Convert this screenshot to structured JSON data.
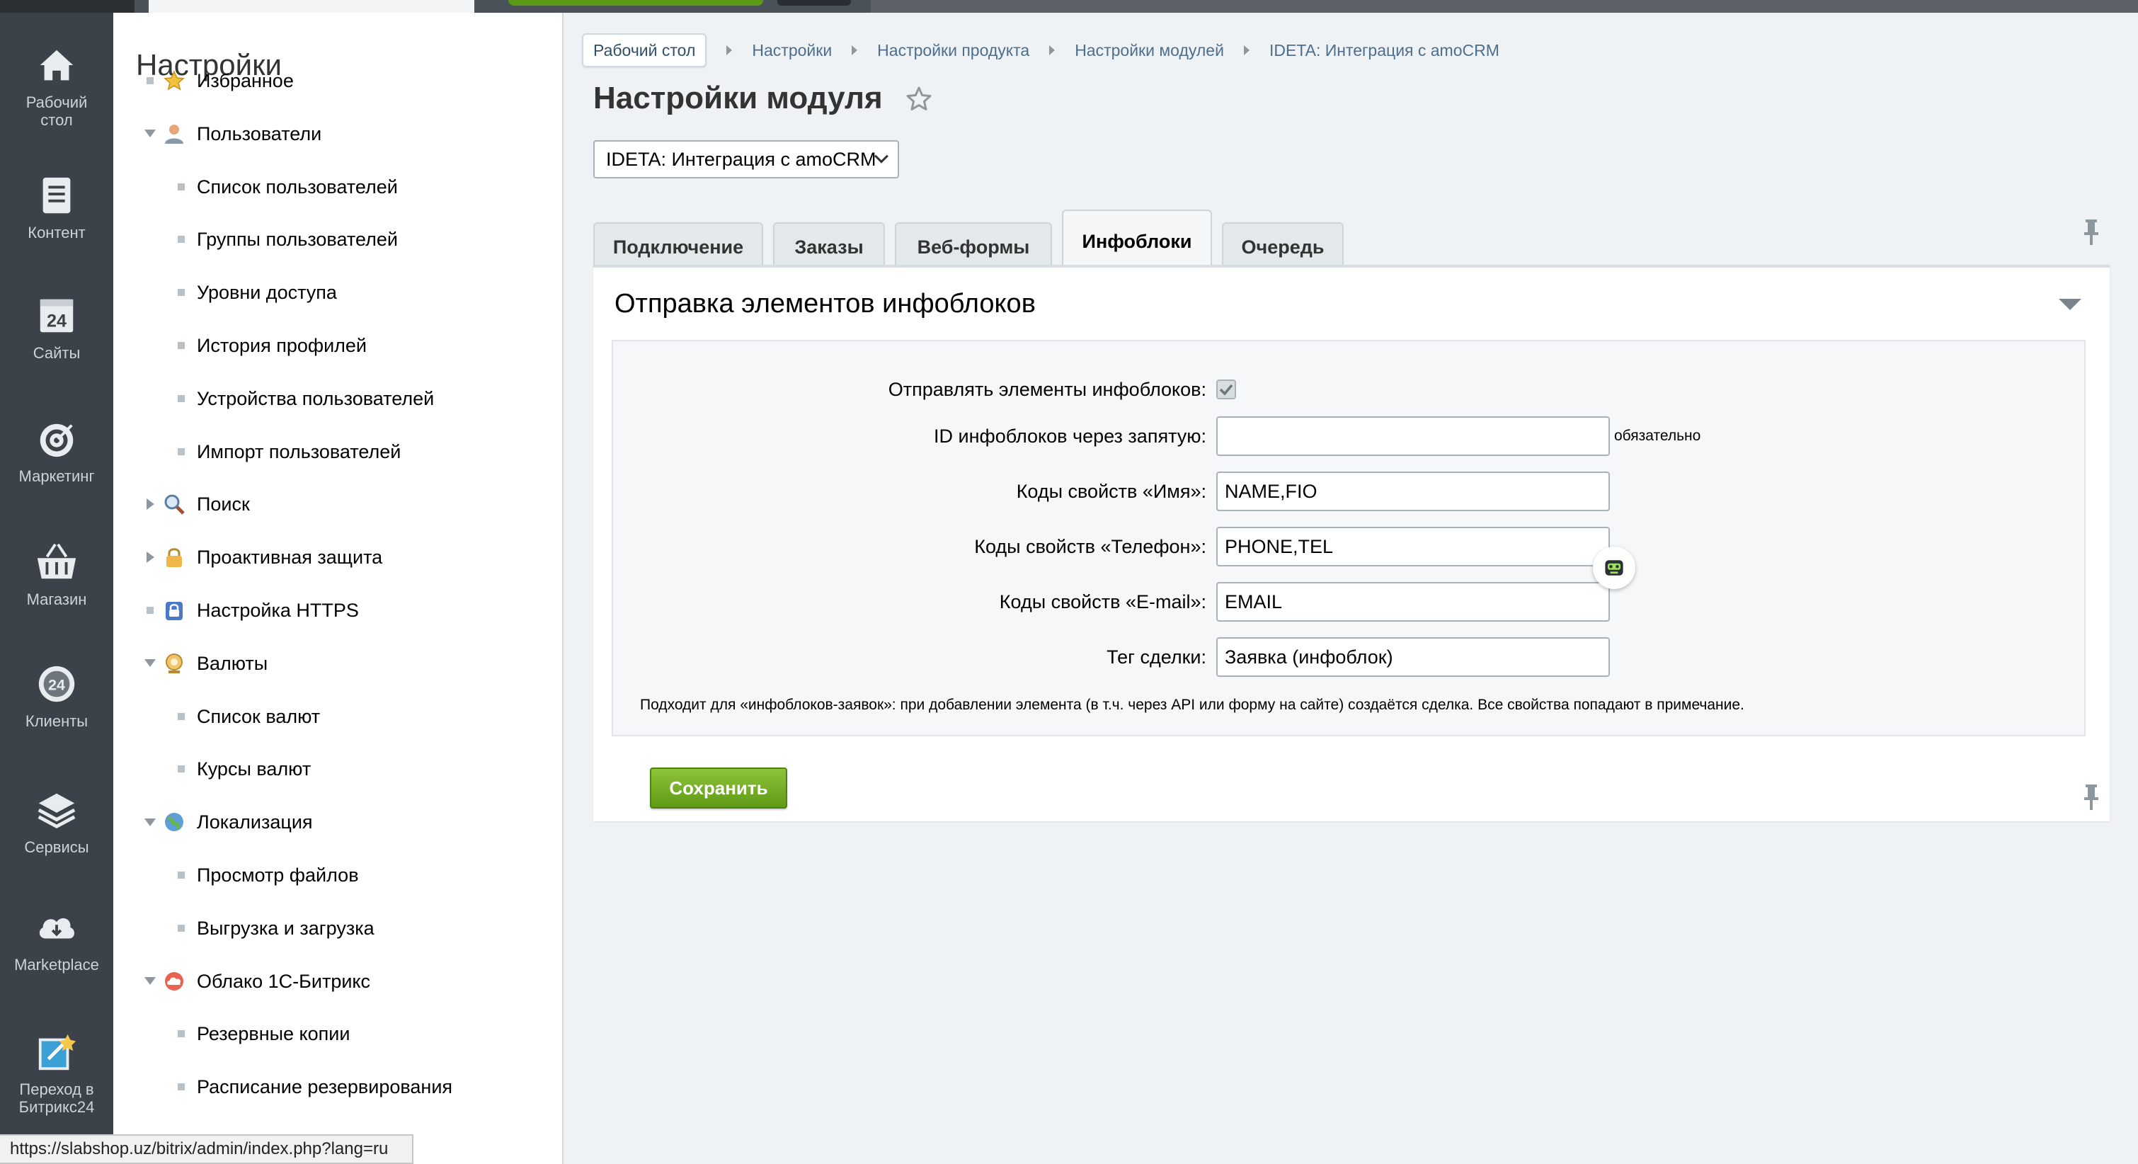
{
  "rail": {
    "items": [
      {
        "label": "Рабочий стол",
        "icon": "home-icon"
      },
      {
        "label": "Контент",
        "icon": "document-icon"
      },
      {
        "label": "Сайты",
        "icon": "calendar-24-icon"
      },
      {
        "label": "Маркетинг",
        "icon": "target-icon"
      },
      {
        "label": "Магазин",
        "icon": "basket-icon"
      },
      {
        "label": "Клиенты",
        "icon": "clients-24-icon"
      },
      {
        "label": "Сервисы",
        "icon": "layers-icon"
      },
      {
        "label": "Marketplace",
        "icon": "cloud-download-icon"
      },
      {
        "label": "Переход в Битрикс24",
        "icon": "external-link-icon"
      }
    ]
  },
  "menu": {
    "title": "Настройки",
    "items": [
      {
        "label": "Избранное",
        "level": 0,
        "marker": "bullet",
        "icon": "star-icon"
      },
      {
        "label": "Пользователи",
        "level": 0,
        "marker": "expanded",
        "icon": "user-icon"
      },
      {
        "label": "Список пользователей",
        "level": 1,
        "marker": "bullet"
      },
      {
        "label": "Группы пользователей",
        "level": 1,
        "marker": "bullet"
      },
      {
        "label": "Уровни доступа",
        "level": 1,
        "marker": "bullet"
      },
      {
        "label": "История профилей",
        "level": 1,
        "marker": "bullet"
      },
      {
        "label": "Устройства пользователей",
        "level": 1,
        "marker": "bullet"
      },
      {
        "label": "Импорт пользователей",
        "level": 1,
        "marker": "bullet"
      },
      {
        "label": "Поиск",
        "level": 0,
        "marker": "collapsed",
        "icon": "search-icon"
      },
      {
        "label": "Проактивная защита",
        "level": 0,
        "marker": "collapsed",
        "icon": "lock-icon"
      },
      {
        "label": "Настройка HTTPS",
        "level": 0,
        "marker": "bullet",
        "icon": "https-lock-icon"
      },
      {
        "label": "Валюты",
        "level": 0,
        "marker": "expanded",
        "icon": "currency-icon"
      },
      {
        "label": "Список валют",
        "level": 1,
        "marker": "bullet"
      },
      {
        "label": "Курсы валют",
        "level": 1,
        "marker": "bullet"
      },
      {
        "label": "Локализация",
        "level": 0,
        "marker": "expanded",
        "icon": "globe-icon"
      },
      {
        "label": "Просмотр файлов",
        "level": 1,
        "marker": "bullet"
      },
      {
        "label": "Выгрузка и загрузка",
        "level": 1,
        "marker": "bullet"
      },
      {
        "label": "Облако 1С-Битрикс",
        "level": 0,
        "marker": "expanded",
        "icon": "cloud-icon"
      },
      {
        "label": "Резервные копии",
        "level": 1,
        "marker": "bullet"
      },
      {
        "label": "Расписание резервирования",
        "level": 1,
        "marker": "bullet"
      }
    ]
  },
  "breadcrumbs": [
    "Рабочий стол",
    "Настройки",
    "Настройки продукта",
    "Настройки модулей",
    "IDETA: Интеграция с amoCRM"
  ],
  "page": {
    "title": "Настройки модуля",
    "module_select": "IDETA: Интеграция с amoCRM"
  },
  "tabs": [
    {
      "label": "Подключение",
      "active": false
    },
    {
      "label": "Заказы",
      "active": false
    },
    {
      "label": "Веб-формы",
      "active": false
    },
    {
      "label": "Инфоблоки",
      "active": true
    },
    {
      "label": "Очередь",
      "active": false
    }
  ],
  "section": {
    "title": "Отправка элементов инфоблоков",
    "fields": {
      "send_label": "Отправлять элементы инфоблоков:",
      "send_checked": true,
      "ids_label": "ID инфоблоков через запятую:",
      "ids_value": "",
      "ids_note": "обязательно",
      "name_label": "Коды свойств «Имя»:",
      "name_value": "NAME,FIO",
      "phone_label": "Коды свойств «Телефон»:",
      "phone_value": "PHONE,TEL",
      "email_label": "Коды свойств «E-mail»:",
      "email_value": "EMAIL",
      "tag_label": "Тег сделки:",
      "tag_value": "Заявка (инфоблок)"
    },
    "hint": "Подходит для «инфоблоков-заявок»: при добавлении элемента (в т.ч. через API или форму на сайте) создаётся сделка. Все свойства попадают в примечание."
  },
  "save_label": "Сохранить",
  "status_url": "https://slabshop.uz/bitrix/admin/index.php?lang=ru",
  "colors": {
    "rail_bg": "#3b424a",
    "accent_green": "#6da823",
    "link": "#4d6e8c"
  }
}
